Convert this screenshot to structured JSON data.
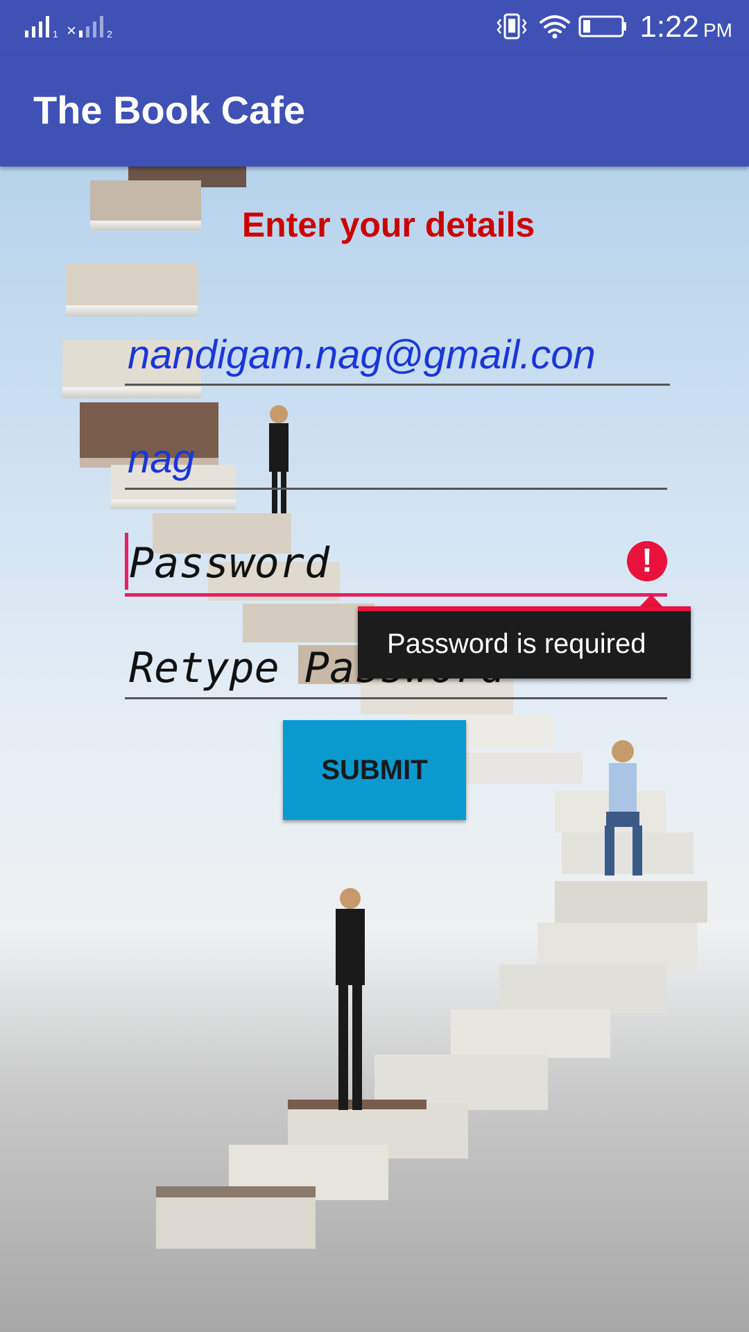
{
  "status_bar": {
    "time": "1:22",
    "ampm": "PM",
    "sim1_label": "1",
    "sim2_label": "2",
    "icons": [
      "signal-sim1-icon",
      "signal-sim2-icon",
      "vibrate-icon",
      "wifi-icon",
      "battery-icon"
    ]
  },
  "app_bar": {
    "title": "The Book Cafe",
    "color": "#3f51b5"
  },
  "form": {
    "heading": "Enter your details",
    "heading_color": "#cc0000",
    "email": {
      "value": "nandigam.nag@gmail.con"
    },
    "username": {
      "value": "nag"
    },
    "password": {
      "placeholder": "Password",
      "value": ""
    },
    "retype_password": {
      "placeholder": "Retype Password",
      "value": ""
    },
    "error": {
      "icon": "!",
      "message": "Password is required",
      "color": "#e8123c"
    },
    "submit_label": "SUBMIT",
    "submit_color": "#0b9ad0"
  }
}
